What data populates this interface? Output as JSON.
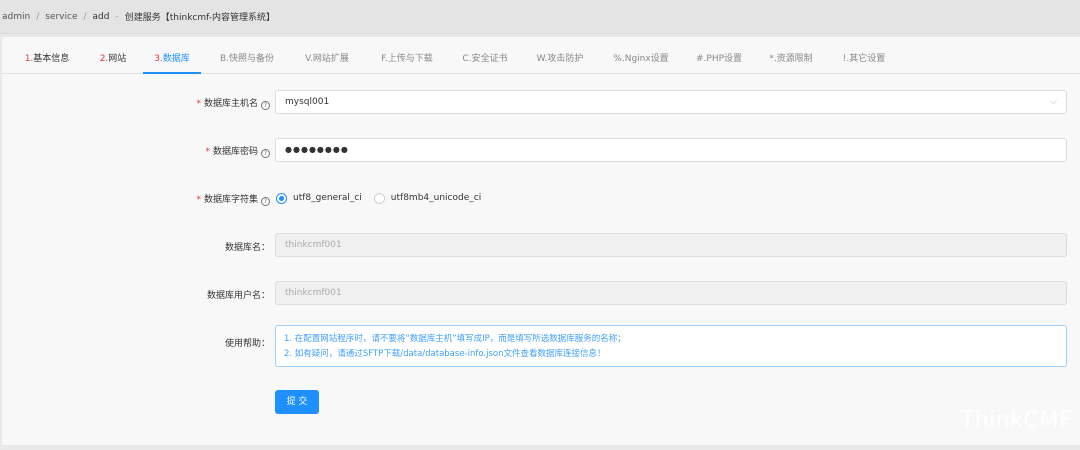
{
  "breadcrumb": {
    "items": [
      "admin",
      "service",
      "add",
      "创建服务【thinkcmf-内容管理系统】"
    ],
    "separators": [
      "/",
      "/",
      "-"
    ]
  },
  "tabs": [
    {
      "num": "1.",
      "label": "基本信息",
      "state": "done"
    },
    {
      "num": "2.",
      "label": "网站",
      "state": "done"
    },
    {
      "num": "3.",
      "label": "数据库",
      "state": "active"
    },
    {
      "num": "",
      "label": "B.快照与备份",
      "state": "pending"
    },
    {
      "num": "",
      "label": "V.网站扩展",
      "state": "pending"
    },
    {
      "num": "",
      "label": "F.上传与下载",
      "state": "pending"
    },
    {
      "num": "",
      "label": "C.安全证书",
      "state": "pending"
    },
    {
      "num": "",
      "label": "W.攻击防护",
      "state": "pending"
    },
    {
      "num": "",
      "label": "%.Nginx设置",
      "state": "pending"
    },
    {
      "num": "",
      "label": "#.PHP设置",
      "state": "pending"
    },
    {
      "num": "",
      "label": "*.资源限制",
      "state": "pending"
    },
    {
      "num": "",
      "label": "!.其它设置",
      "state": "pending"
    }
  ],
  "form": {
    "db_host": {
      "label": "数据库主机名",
      "value": "mysql001",
      "required": true
    },
    "db_password": {
      "label": "数据库密码",
      "value": "●●●●●●●●",
      "required": true
    },
    "db_charset": {
      "label": "数据库字符集",
      "required": true,
      "options": [
        "utf8_general_ci",
        "utf8mb4_unicode_ci"
      ],
      "selected": "utf8_general_ci"
    },
    "db_name": {
      "label": "数据库名：",
      "placeholder": "thinkcmf001"
    },
    "db_user": {
      "label": "数据库用户名：",
      "placeholder": "thinkcmf001"
    },
    "help": {
      "label": "使用帮助：",
      "lines": [
        "1. 在配置网站程序时，请不要将“数据库主机”填写成IP，而是填写所选数据库服务的名称；",
        "2. 如有疑问，请通过SFTP下载/data/database-info.json文件查看数据库连接信息！"
      ]
    },
    "submit_label": "提 交"
  },
  "question_glyph": "?",
  "required_mark": "*",
  "watermark": "ThinkCMF",
  "colors": {
    "accent": "#1e90ff",
    "required": "#e4393c",
    "help_text": "#409eff"
  },
  "icons": {
    "select_arrow": "chevron-down-icon",
    "help": "question-circle-icon"
  }
}
